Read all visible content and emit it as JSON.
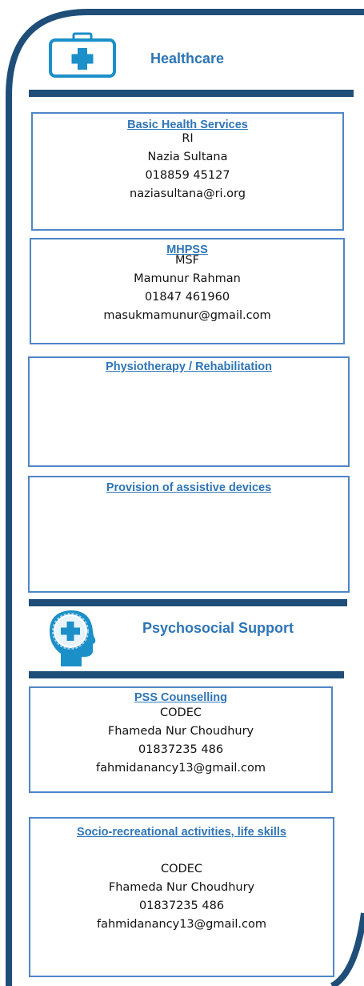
{
  "sections": [
    {
      "title": "Healthcare",
      "icon": "medical-kit-icon",
      "services": [
        {
          "heading": "Basic Health Services",
          "org": "RI",
          "contact": "Nazia Sultana",
          "phone": "018859 45127",
          "email": "naziasultana@ri.org"
        },
        {
          "heading": "MHPSS",
          "org": "MSF",
          "contact": "Mamunur Rahman",
          "phone": "01847 461960",
          "email": "masukmamunur@gmail.com"
        },
        {
          "heading": "Physiotherapy / Rehabilitation"
        },
        {
          "heading": "Provision of assistive devices"
        }
      ]
    },
    {
      "title": "Psychosocial Support",
      "icon": "head-medical-cross-icon",
      "services": [
        {
          "heading": "PSS Counselling",
          "org": "CODEC",
          "contact": "Fhameda Nur Choudhury",
          "phone": "01837235 486",
          "email": "fahmidanancy13@gmail.com"
        },
        {
          "heading": "Socio-recreational activities, life skills",
          "org": "CODEC",
          "contact": "Fhameda Nur Choudhury",
          "phone": "01837235 486",
          "email": "fahmidanancy13@gmail.com"
        }
      ]
    }
  ],
  "colors": {
    "frame": "#1f4e79",
    "accent": "#2e75b6",
    "card_border": "#4f86c6"
  }
}
